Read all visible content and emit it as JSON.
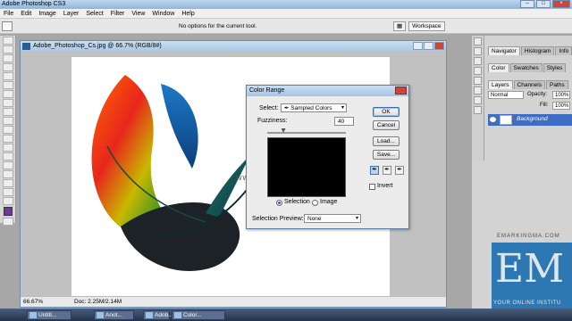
{
  "app": {
    "title": "Adobe Photoshop CS3"
  },
  "menu": [
    "File",
    "Edit",
    "Image",
    "Layer",
    "Select",
    "Filter",
    "View",
    "Window",
    "Help"
  ],
  "options_bar": {
    "message": "No options for the current tool.",
    "workspace_label": "Workspace"
  },
  "document": {
    "title": "Adobe_Photoshop_Cs.jpg @ 66.7% (RGB/8#)",
    "zoom": "66.67%",
    "doc_info": "Doc: 2.25M/2.14M",
    "watermark": "www.e"
  },
  "color_range_dialog": {
    "title": "Color Range",
    "select_label": "Select:",
    "select_value": "Sampled Colors",
    "fuzziness_label": "Fuzziness:",
    "fuzziness_value": "40",
    "fuzziness_fraction": 0.2,
    "ok_label": "OK",
    "cancel_label": "Cancel",
    "load_label": "Load...",
    "save_label": "Save...",
    "selection_radio": "Selection",
    "image_radio": "Image",
    "invert_label": "Invert",
    "preview_label": "Selection Preview:",
    "preview_value": "None"
  },
  "panels": {
    "navigator_tabs": [
      "Navigator",
      "Histogram",
      "Info"
    ],
    "color_tabs": [
      "Color",
      "Swatches",
      "Styles"
    ],
    "layers_tabs": [
      "Layers",
      "Channels",
      "Paths"
    ],
    "blend_mode": "Normal",
    "opacity_label": "Opacity:",
    "opacity_value": "100%",
    "fill_label": "Fill:",
    "fill_value": "100%",
    "layer_name": "Background"
  },
  "taskbar": [
    "Untitl...",
    "Anot...",
    "Adob...",
    "Color..."
  ],
  "branding": {
    "logo": "EM",
    "tagline": "YOUR ONLINE INSTITU",
    "site": "EMARKINGMA.COM"
  }
}
